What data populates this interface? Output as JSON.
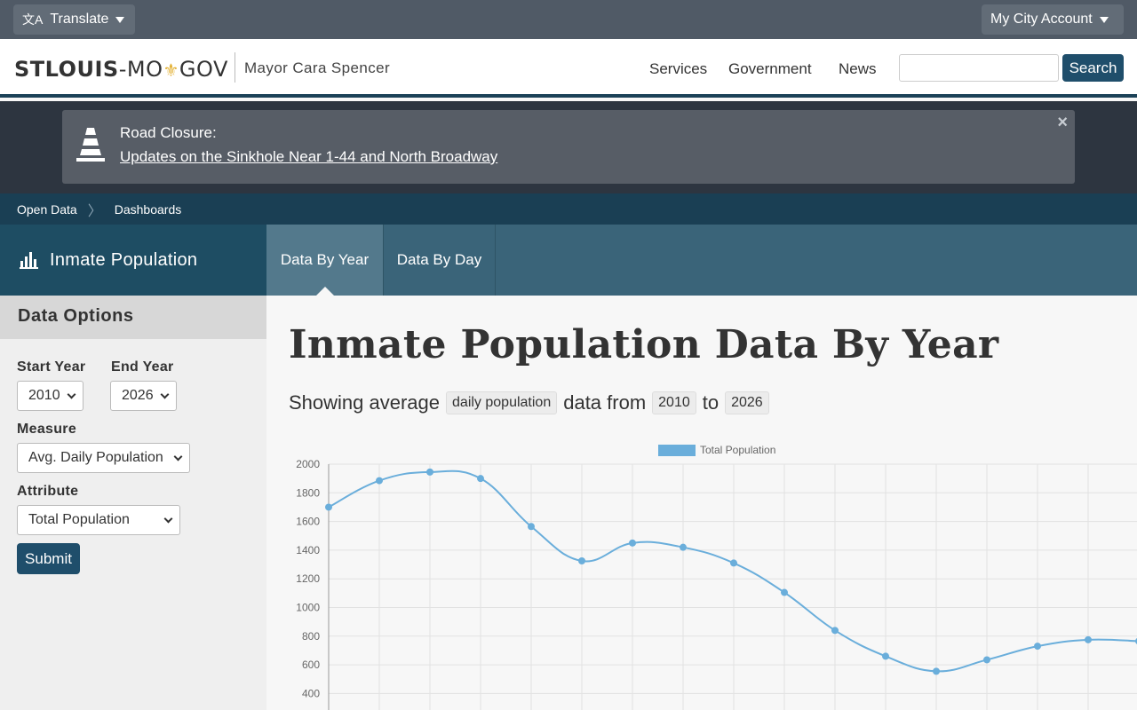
{
  "topbar": {
    "translate_label": "Translate",
    "account_label": "My City Account"
  },
  "header": {
    "logo_bold": "STLOUIS",
    "logo_dash": "-MO",
    "logo_gov": "GOV",
    "mayor": "Mayor Cara Spencer",
    "nav": [
      "Services",
      "Government",
      "News"
    ],
    "search_placeholder": "",
    "search_button": "Search"
  },
  "alert": {
    "title": "Road Closure:",
    "link": "Updates on the Sinkhole Near 1-44 and North Broadway",
    "close": "×"
  },
  "breadcrumb": [
    "Open Data",
    "Dashboards"
  ],
  "dashboard": {
    "title": "Inmate Population",
    "tabs": [
      "Data By Year",
      "Data By Day"
    ],
    "active_tab": "Data By Year"
  },
  "sidebar": {
    "heading": "Data Options",
    "start_year_label": "Start Year",
    "start_year_value": "2010",
    "end_year_label": "End Year",
    "end_year_value": "2026",
    "measure_label": "Measure",
    "measure_value": "Avg. Daily Population",
    "attribute_label": "Attribute",
    "attribute_value": "Total Population",
    "submit_label": "Submit"
  },
  "main": {
    "heading": "Inmate Population Data By Year",
    "showing_prefix": "Showing average",
    "measure_tag": "daily population",
    "data_from": "data from",
    "start_tag": "2010",
    "to": "to",
    "end_tag": "2026"
  },
  "colors": {
    "line": "#6aaedb",
    "navy": "#1f4e6b"
  },
  "chart_data": {
    "type": "line",
    "series": [
      {
        "name": "Total Population",
        "values": [
          1700,
          1885,
          1945,
          1900,
          1565,
          1325,
          1450,
          1420,
          1310,
          1105,
          840,
          660,
          555,
          635,
          730,
          775,
          765
        ]
      }
    ],
    "yticks": [
      2000,
      1800,
      1600,
      1400,
      1200,
      1000,
      800,
      600,
      400
    ],
    "ylim": [
      400,
      2000
    ],
    "grid": true,
    "legend": "top"
  }
}
